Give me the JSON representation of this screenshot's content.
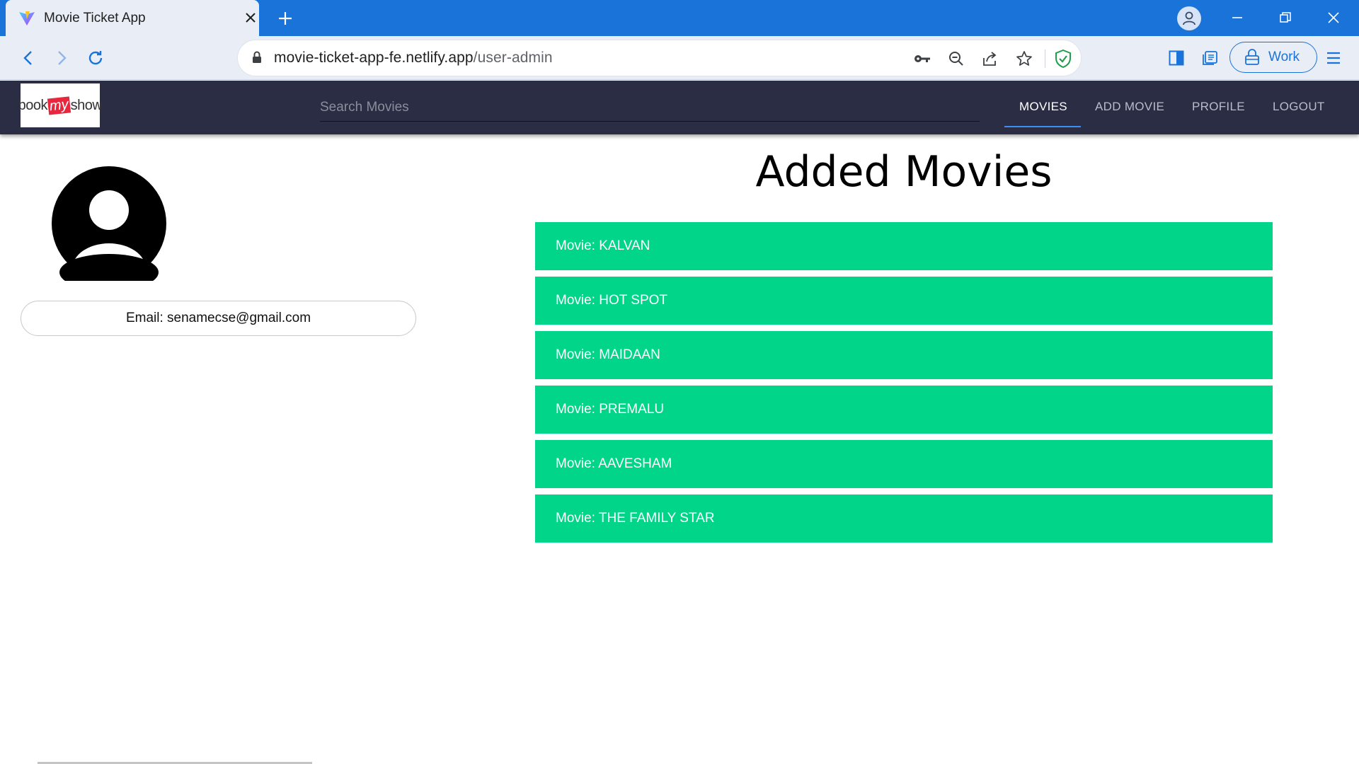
{
  "browser": {
    "tab_title": "Movie Ticket App",
    "url_host": "movie-ticket-app-fe.netlify.app",
    "url_path": "/user-admin",
    "profile_label": "Work",
    "accent_color": "#1a73d8"
  },
  "navbar": {
    "logo_text": {
      "book": "book",
      "my": "my",
      "show": "show"
    },
    "search_placeholder": "Search Movies",
    "links": [
      {
        "label": "MOVIES",
        "active": true
      },
      {
        "label": "ADD MOVIE",
        "active": false
      },
      {
        "label": "PROFILE",
        "active": false
      },
      {
        "label": "LOGOUT",
        "active": false
      }
    ],
    "background": "#2a2d43"
  },
  "profile": {
    "email_text": "Email: senamecse@gmail.com"
  },
  "movies": {
    "heading": "Added Movies",
    "card_color": "#00d589",
    "items": [
      {
        "label": "Movie: KALVAN"
      },
      {
        "label": "Movie: HOT SPOT"
      },
      {
        "label": "Movie: MAIDAAN"
      },
      {
        "label": "Movie: PREMALU"
      },
      {
        "label": "Movie: AAVESHAM"
      },
      {
        "label": "Movie: THE FAMILY STAR"
      }
    ]
  }
}
